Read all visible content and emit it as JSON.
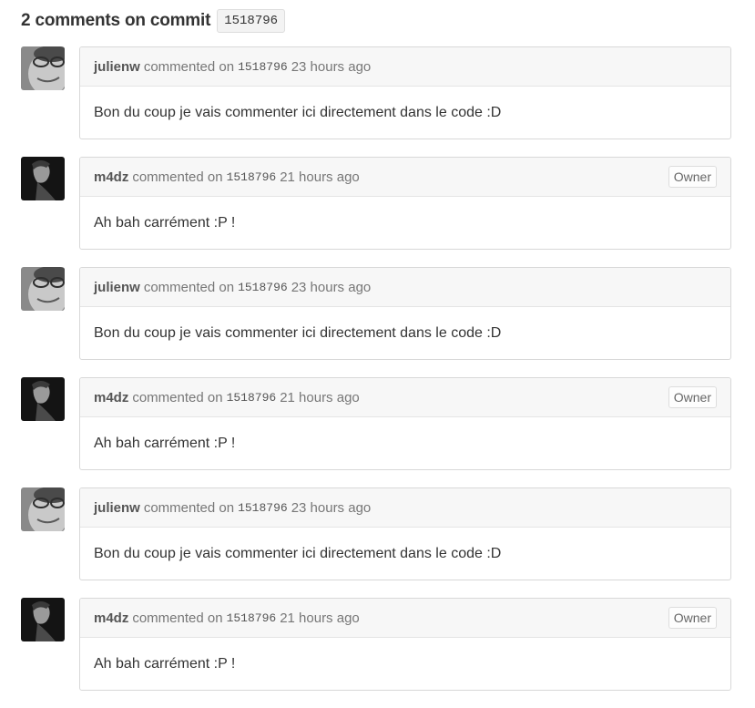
{
  "heading": {
    "text": "2 comments on commit",
    "sha": "1518796"
  },
  "comments": [
    {
      "author": "julienw",
      "action": "commented on",
      "sha": "1518796",
      "time": "23 hours ago",
      "badge": "",
      "body": "Bon du coup je vais commenter ici directement dans le code :D",
      "avatar": "julienw-avatar"
    },
    {
      "author": "m4dz",
      "action": "commented on",
      "sha": "1518796",
      "time": "21 hours ago",
      "badge": "Owner",
      "body": "Ah bah carrément :P !",
      "avatar": "m4dz-avatar"
    },
    {
      "author": "julienw",
      "action": "commented on",
      "sha": "1518796",
      "time": "23 hours ago",
      "badge": "",
      "body": "Bon du coup je vais commenter ici directement dans le code :D",
      "avatar": "julienw-avatar"
    },
    {
      "author": "m4dz",
      "action": "commented on",
      "sha": "1518796",
      "time": "21 hours ago",
      "badge": "Owner",
      "body": "Ah bah carrément :P !",
      "avatar": "m4dz-avatar"
    },
    {
      "author": "julienw",
      "action": "commented on",
      "sha": "1518796",
      "time": "23 hours ago",
      "badge": "",
      "body": "Bon du coup je vais commenter ici directement dans le code :D",
      "avatar": "julienw-avatar"
    },
    {
      "author": "m4dz",
      "action": "commented on",
      "sha": "1518796",
      "time": "21 hours ago",
      "badge": "Owner",
      "body": "Ah bah carrément :P !",
      "avatar": "m4dz-avatar"
    }
  ]
}
